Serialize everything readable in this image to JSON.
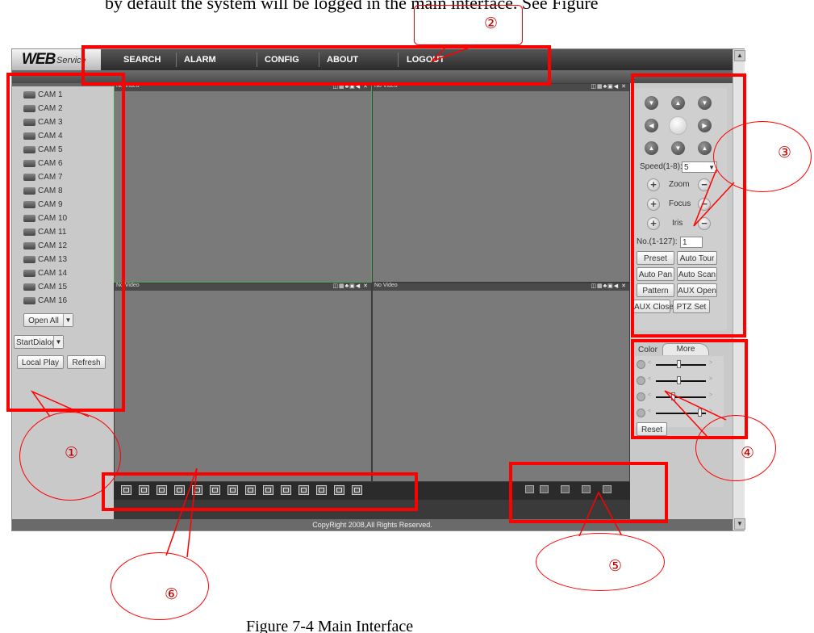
{
  "document": {
    "top_text": "by default the system will be logged in the main interface. See Figure",
    "caption": "Figure 7-4 Main Interface"
  },
  "app": {
    "logo_main": "WEB",
    "logo_sub": "Service",
    "menu": [
      "SEARCH",
      "ALARM",
      "CONFIG",
      "ABOUT",
      "LOGOUT"
    ],
    "cameras": [
      "CAM 1",
      "CAM 2",
      "CAM 3",
      "CAM 4",
      "CAM 5",
      "CAM 6",
      "CAM 7",
      "CAM 8",
      "CAM 9",
      "CAM 10",
      "CAM 11",
      "CAM 12",
      "CAM 13",
      "CAM 14",
      "CAM 15",
      "CAM 16"
    ],
    "open_all": "Open All",
    "start_dialog": "StartDialog",
    "local_play": "Local Play",
    "refresh": "Refresh",
    "pane_title": "No Video",
    "pane_tools": "◫▦♣▣◀ ✕",
    "footer": "CopyRight 2008,All Rights Reserved."
  },
  "ptz": {
    "speed_label": "Speed(1-8):",
    "speed_value": "5",
    "zoom": "Zoom",
    "focus": "Focus",
    "iris": "Iris",
    "no_label": "No.(1-127):",
    "no_value": "1",
    "preset": "Preset",
    "auto_tour": "Auto Tour",
    "auto_pan": "Auto Pan",
    "auto_scan": "Auto Scan",
    "pattern": "Pattern",
    "aux_open": "AUX Open",
    "aux_close": "AUX Close",
    "ptz_set": "PTZ Set"
  },
  "color": {
    "tab_color": "Color",
    "tab_more": "More",
    "reset": "Reset",
    "levels": [
      0.6,
      0.6,
      0.5,
      0.85
    ]
  },
  "annotations": [
    "①",
    "②",
    "③",
    "④",
    "⑤",
    "⑥"
  ]
}
